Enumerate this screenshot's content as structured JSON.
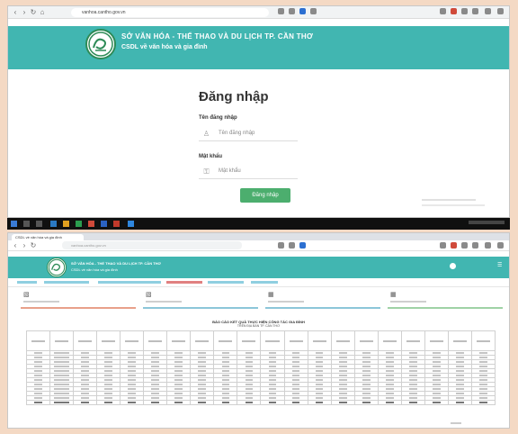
{
  "login_page": {
    "browser_url_host": "vanhoa.cantho.gov.vn",
    "header_title": "SỞ VĂN HÓA - THỂ THAO VÀ DU LỊCH TP. CẦN THƠ",
    "header_subtitle": "CSDL về văn hóa và gia đình",
    "form_title": "Đăng nhập",
    "username_label": "Tên đăng nhập",
    "username_placeholder": "Tên đăng nhập",
    "password_label": "Mật khẩu",
    "password_placeholder": "Mật khẩu",
    "login_button": "Đăng nhập"
  },
  "dashboard_page": {
    "tab_label": "CSDL về văn hóa và gia đình",
    "browser_url_host": "vanhoa.cantho.gov.vn",
    "header_title": "SỞ VĂN HÓA - THỂ THAO VÀ DU LỊCH TP. CẦN THƠ",
    "header_subtitle": "CSDL về văn hóa và gia đình",
    "report_title": "BÁO CÁO KẾT QUẢ THỰC HIỆN CÔNG TÁC GIA ĐÌNH",
    "report_subtitle": "TRÊN ĐỊA BÀN TP. CẦN THƠ"
  },
  "colors": {
    "accent": "#41b6b1",
    "button_green": "#4cae6e",
    "page_background": "#f4d9c4",
    "taskbar": "#101010"
  },
  "icons": {
    "logo": "city-emblem",
    "username": "user-icon",
    "password": "lock-icon"
  }
}
